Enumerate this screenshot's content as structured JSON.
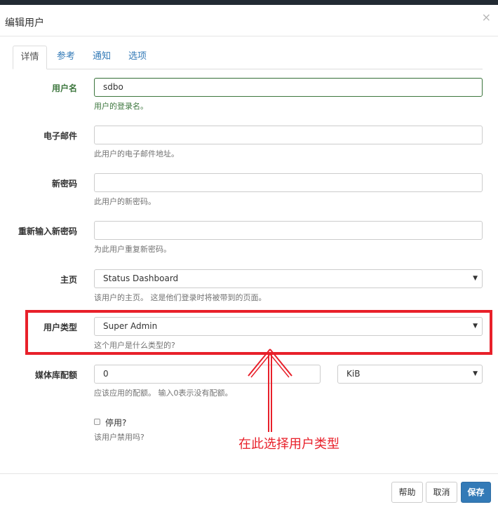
{
  "dialog": {
    "title": "编辑用户",
    "close_glyph": "×"
  },
  "tabs": [
    {
      "label": "详情",
      "active": true
    },
    {
      "label": "参考",
      "active": false
    },
    {
      "label": "通知",
      "active": false
    },
    {
      "label": "选项",
      "active": false
    }
  ],
  "form": {
    "username": {
      "label": "用户名",
      "value": "sdbo",
      "help": "用户的登录名。"
    },
    "email": {
      "label": "电子邮件",
      "value": "",
      "help": "此用户的电子邮件地址。"
    },
    "new_password": {
      "label": "新密码",
      "value": "",
      "help": "此用户的新密码。"
    },
    "confirm_password": {
      "label": "重新输入新密码",
      "value": "",
      "help": "为此用户重复新密码。"
    },
    "home_page": {
      "label": "主页",
      "selected": "Status Dashboard",
      "help": "该用户的主页。 这是他们登录时将被带到的页面。"
    },
    "user_type": {
      "label": "用户类型",
      "selected": "Super Admin",
      "help": "这个用户是什么类型的?"
    },
    "media_quota": {
      "label": "媒体库配额",
      "value": "0",
      "unit": "KiB",
      "help": "应该应用的配额。 输入0表示没有配额。"
    },
    "disabled": {
      "label": "停用?",
      "checked": false,
      "help": "该用户禁用吗?"
    }
  },
  "annotation": {
    "text": "在此选择用户类型",
    "color": "#e8202a"
  },
  "footer": {
    "help_label": "帮助",
    "cancel_label": "取消",
    "save_label": "保存"
  },
  "colors": {
    "accent": "#337ab7",
    "success": "#3c763d",
    "annotation": "#e8202a"
  },
  "icons": {
    "close": "close-icon",
    "caret": "caret-down-icon",
    "arrow": "arrow-up-icon"
  }
}
